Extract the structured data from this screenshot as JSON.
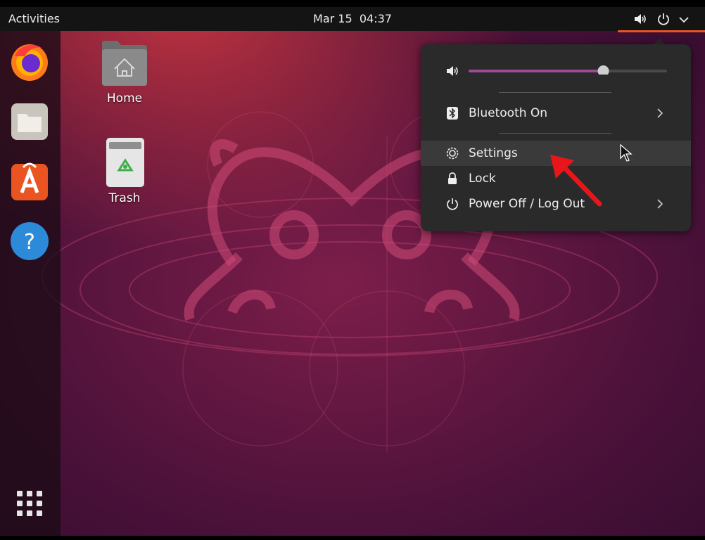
{
  "topbar": {
    "activities_label": "Activities",
    "date": "Mar 15",
    "time": "04:37",
    "tray_icons": [
      "volume-icon",
      "power-icon",
      "chevron-down-icon"
    ],
    "accent_color": "#e95420"
  },
  "dock": {
    "apps": [
      "firefox-icon",
      "files-icon",
      "software-icon",
      "help-icon"
    ],
    "show_apps_icon": "app-grid-icon"
  },
  "desktop": {
    "icons": [
      {
        "label": "Home",
        "icon": "home-folder-icon"
      },
      {
        "label": "Trash",
        "icon": "trash-icon"
      }
    ]
  },
  "system_menu": {
    "volume": {
      "icon": "volume-icon",
      "level": 0.69,
      "fill_color": "#9e4a95"
    },
    "items": [
      {
        "label": "Bluetooth On",
        "icon": "bluetooth-icon",
        "has_submenu": true
      },
      {
        "label": "Settings",
        "icon": "settings-gear-icon",
        "has_submenu": false,
        "highlighted": true
      },
      {
        "label": "Lock",
        "icon": "lock-icon",
        "has_submenu": false
      },
      {
        "label": "Power Off / Log Out",
        "icon": "power-icon",
        "has_submenu": true
      }
    ]
  },
  "annotation": {
    "color": "#e8151b",
    "points_to": "Settings"
  }
}
